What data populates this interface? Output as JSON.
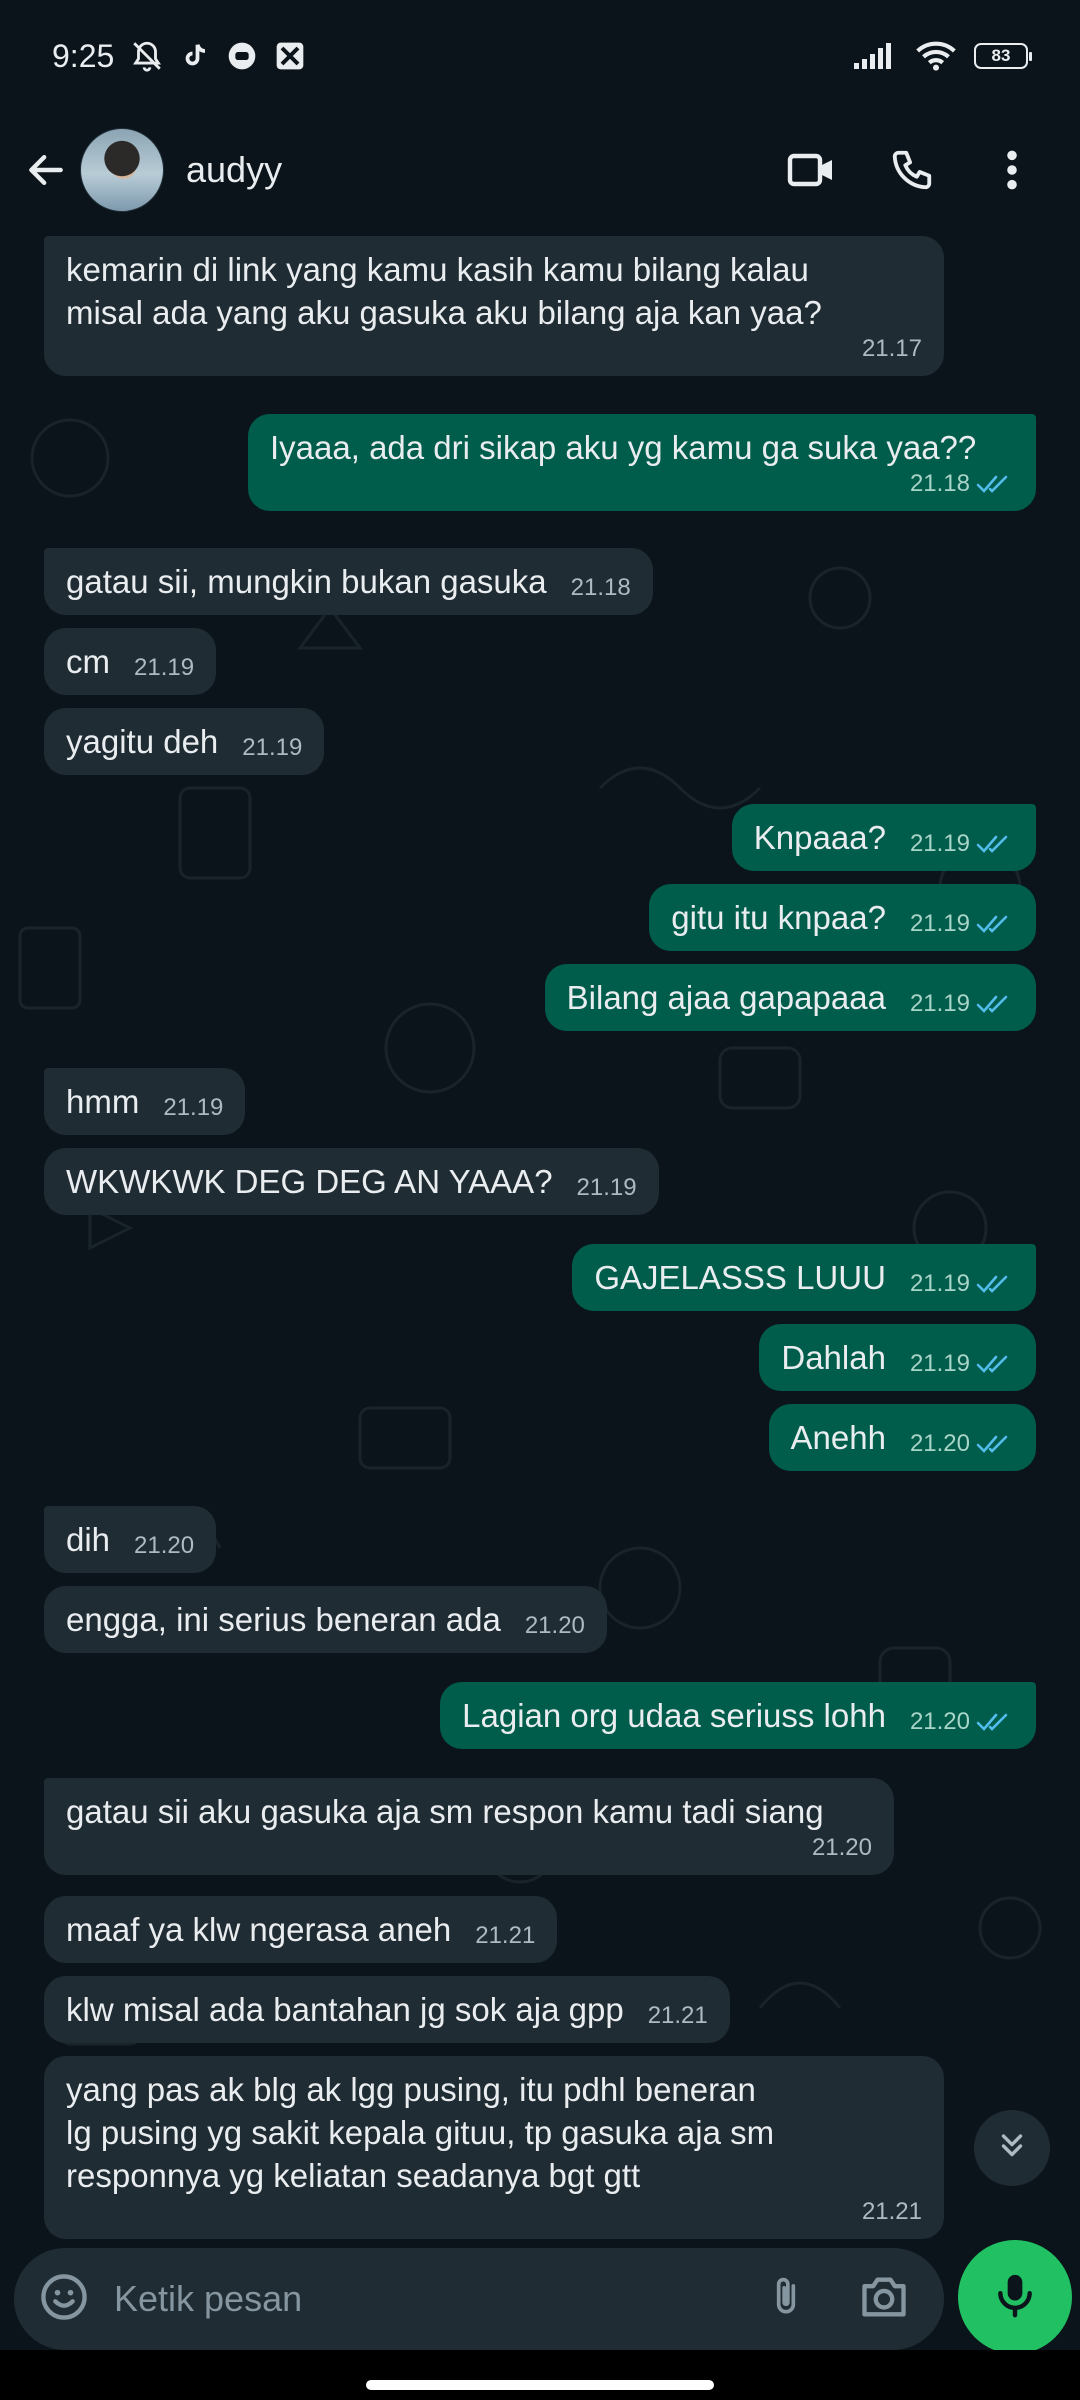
{
  "status_bar": {
    "time": "9:25",
    "battery": "83",
    "left_icons": [
      "bell-off-icon",
      "tiktok-icon",
      "chat-bubble-icon",
      "app-icon"
    ],
    "right_icons": [
      "signal-icon",
      "wifi-icon",
      "battery-icon"
    ]
  },
  "header": {
    "contact_name": "audyy",
    "actions": [
      "video-call-icon",
      "voice-call-icon",
      "more-options-icon"
    ]
  },
  "colors": {
    "background": "#0b141a",
    "incoming_bubble": "#202c33",
    "outgoing_bubble": "#005c4b",
    "read_ticks": "#53bdeb",
    "mic_button": "#21c063"
  },
  "messages": [
    {
      "dir": "in",
      "text": "kemarin di link yang kamu kasih kamu bilang kalau\nmisal ada yang aku gasuka aku bilang aja kan yaa?",
      "time": "21.17"
    },
    {
      "dir": "out",
      "text": "Iyaaa, ada dri sikap aku yg kamu ga suka yaa??",
      "time": "21.18",
      "status": "read"
    },
    {
      "dir": "in",
      "text": "gatau sii, mungkin bukan gasuka",
      "time": "21.18"
    },
    {
      "dir": "in",
      "text": "cm",
      "time": "21.19"
    },
    {
      "dir": "in",
      "text": "yagitu deh",
      "time": "21.19"
    },
    {
      "dir": "out",
      "text": "Knpaaa?",
      "time": "21.19",
      "status": "read"
    },
    {
      "dir": "out",
      "text": "gitu itu knpaa?",
      "time": "21.19",
      "status": "read"
    },
    {
      "dir": "out",
      "text": "Bilang ajaa gapapaaa",
      "time": "21.19",
      "status": "read"
    },
    {
      "dir": "in",
      "text": "hmm",
      "time": "21.19"
    },
    {
      "dir": "in",
      "text": "WKWKWK DEG DEG AN YAAA?",
      "time": "21.19"
    },
    {
      "dir": "out",
      "text": "GAJELASSS LUUU",
      "time": "21.19",
      "status": "read"
    },
    {
      "dir": "out",
      "text": "Dahlah",
      "time": "21.19",
      "status": "read"
    },
    {
      "dir": "out",
      "text": "Anehh",
      "time": "21.20",
      "status": "read"
    },
    {
      "dir": "in",
      "text": "dih",
      "time": "21.20"
    },
    {
      "dir": "in",
      "text": "engga, ini serius beneran ada",
      "time": "21.20"
    },
    {
      "dir": "out",
      "text": "Lagian org udaa seriuss lohh",
      "time": "21.20",
      "status": "read"
    },
    {
      "dir": "in",
      "text": "gatau sii aku gasuka aja sm respon kamu tadi siang",
      "time": "21.20"
    },
    {
      "dir": "in",
      "text": "maaf ya klw ngerasa aneh",
      "time": "21.21"
    },
    {
      "dir": "in",
      "text": "klw misal ada bantahan jg sok aja gpp",
      "time": "21.21"
    },
    {
      "dir": "in",
      "text": "yang pas ak blg ak lgg pusing, itu pdhl beneran\nlg pusing yg sakit kepala gituu, tp gasuka aja sm\nresponnya yg keliatan seadanya bgt gtt",
      "time": "21.21"
    }
  ],
  "composer": {
    "placeholder": "Ketik pesan",
    "icons": [
      "emoji-icon",
      "attach-icon",
      "camera-icon",
      "mic-icon"
    ]
  }
}
